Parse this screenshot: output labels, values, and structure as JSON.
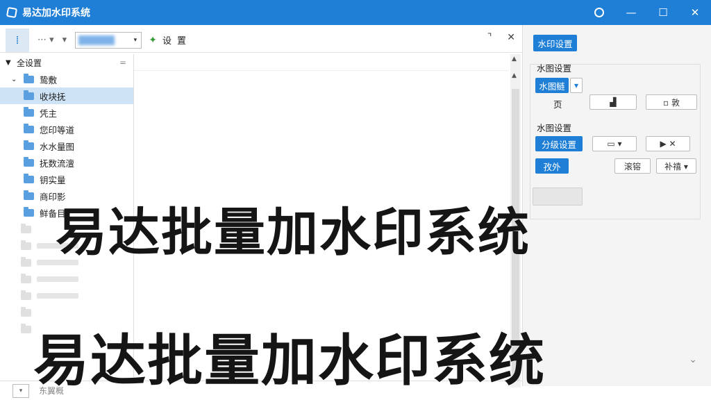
{
  "window": {
    "title": "易达加水印系统",
    "controls": {
      "minimize": "—",
      "maximize": "☐",
      "close": "✕"
    }
  },
  "toolbar": {
    "pin_icon": "⁞",
    "small_a": "⋯ ▾",
    "small_b": "▾",
    "dropdown_caret": "▾",
    "leaf": "✦",
    "label_1": "设",
    "label_2": "置",
    "right_1": "⌝",
    "right_2": "✕"
  },
  "tree": {
    "root_label": "全设置",
    "root_more": "=",
    "expanded_group": "鸷敷",
    "items": [
      "收块抚",
      "凭主",
      "您印等道",
      "水水量图",
      "抚数流澶",
      "钥实量",
      "商印影",
      "鲜备目"
    ]
  },
  "panel": {
    "tab_label": "水印设置",
    "section1_title": "水图设置",
    "type_btn": "水图鲢",
    "type_caret": "▾",
    "page_label": "页",
    "sel1": "▟",
    "sel2": "▫ 敦",
    "section2_title": "水图设置",
    "layer_btn": "分级设置",
    "shape_btn": "▭ ▾",
    "play_btn": "▶ ✕",
    "apply_btn": "孜外",
    "btn_a": "滚镕",
    "btn_b": "补禧 ▾"
  },
  "status": {
    "box": "▾",
    "text": "东翼概"
  },
  "overlay": {
    "line1": "易达批量加水印系统",
    "line2": "易达批量加水印系统"
  },
  "colors": {
    "accent": "#1f7fd6",
    "selection": "#cfe3f7",
    "folder": "#5a9fe0"
  }
}
